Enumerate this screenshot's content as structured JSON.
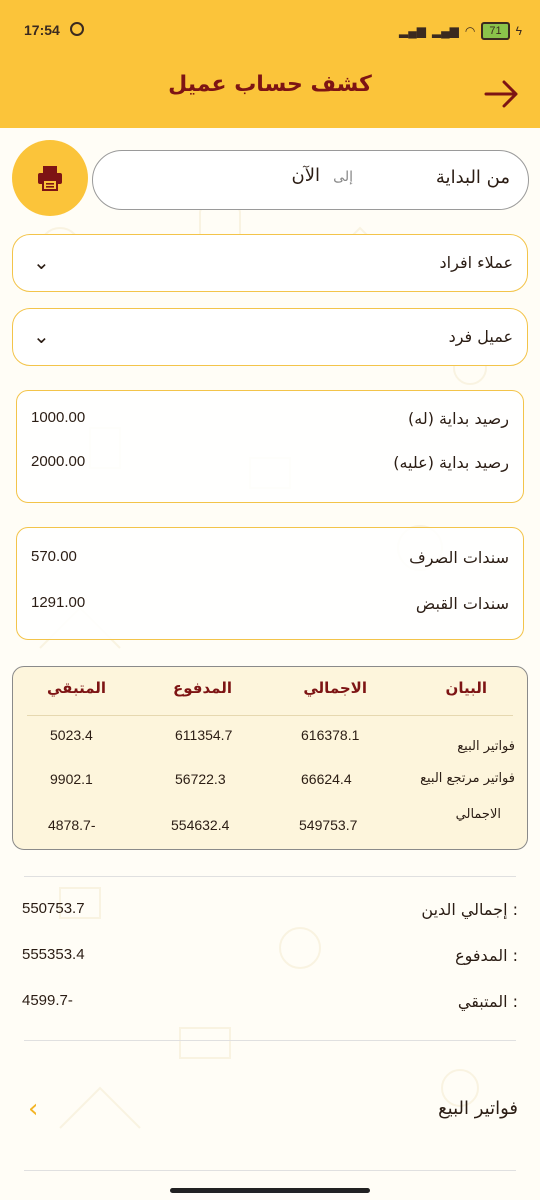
{
  "status_bar": {
    "time": "17:54",
    "battery": "71"
  },
  "app_bar": {
    "title": "كشف حساب عميل",
    "back_icon": "arrow-right-icon"
  },
  "colors": {
    "accent": "#fbc43a",
    "title": "#7d1414",
    "card_border": "#f3c44a",
    "table_bg": "#fdf5dc"
  },
  "date_range": {
    "from": "من البداية",
    "to_prefix": "إلى",
    "to": "الآن"
  },
  "filters": {
    "customer_type": "عملاء افراد",
    "customer": "عميل فرد"
  },
  "opening_balance": {
    "credit_label": "رصيد بداية (له)",
    "credit_value": "1000.00",
    "debit_label": "رصيد بداية (عليه)",
    "debit_value": "2000.00"
  },
  "vouchers": {
    "payment_label": "سندات الصرف",
    "payment_value": "570.00",
    "receipt_label": "سندات القبض",
    "receipt_value": "1291.00"
  },
  "table": {
    "headers": {
      "description": "البيان",
      "total": "الاجمالي",
      "paid": "المدفوع",
      "remaining": "المتبقي"
    },
    "rows": [
      {
        "description": "فواتير البيع",
        "total": "616378.1",
        "paid": "611354.7",
        "remaining": "5023.4"
      },
      {
        "description": "فواتير مرتجع البيع",
        "total": "66624.4",
        "paid": "56722.3",
        "remaining": "9902.1"
      },
      {
        "description": "الاجمالي",
        "total": "549753.7",
        "paid": "554632.4",
        "remaining": "4878.7-"
      }
    ]
  },
  "summary": {
    "total_debt_label": "إجمالي الدين :",
    "total_debt_value": "550753.7",
    "paid_label": "المدفوع :",
    "paid_value": "555353.4",
    "remaining_label": "المتبقي :",
    "remaining_value": "4599.7-"
  },
  "nav": {
    "sales_invoices": "فواتير البيع"
  }
}
